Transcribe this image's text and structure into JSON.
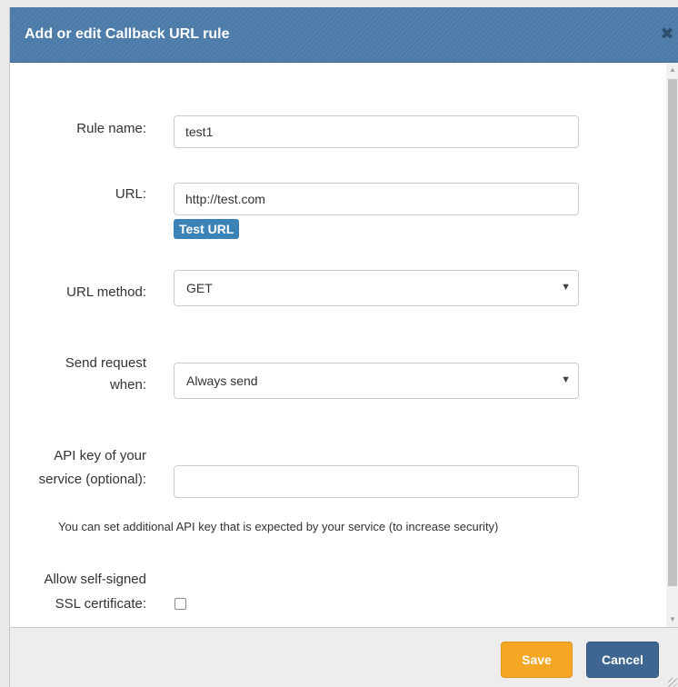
{
  "dialog": {
    "title": "Add or edit Callback URL rule",
    "close_icon": "close-icon",
    "close_glyph": "✖"
  },
  "form": {
    "rule_name": {
      "label": "Rule name:",
      "value": "test1"
    },
    "url": {
      "label": "URL:",
      "value": "http://test.com",
      "test_button": "Test URL"
    },
    "url_method": {
      "label": "URL method:",
      "value": "GET"
    },
    "send_request": {
      "label_line1": "Send request",
      "label_line2": "when:",
      "value": "Always send"
    },
    "api_key": {
      "label_line1": "API key of your",
      "label_line2": "service (optional):",
      "value": "",
      "help": "You can set additional API key that is expected by your service (to increase security)"
    },
    "self_signed": {
      "label_line1": "Allow self-signed",
      "label_line2": "SSL certificate:",
      "checked": false
    }
  },
  "footer": {
    "save_label": "Save",
    "cancel_label": "Cancel"
  },
  "icons": {
    "caret": "▼",
    "scroll_up": "▲",
    "scroll_down": "▼"
  },
  "colors": {
    "title_bar": "#4a7aa8",
    "test_url_button": "#3b82b6",
    "save_button": "#f5a623",
    "cancel_button": "#3f6690"
  }
}
